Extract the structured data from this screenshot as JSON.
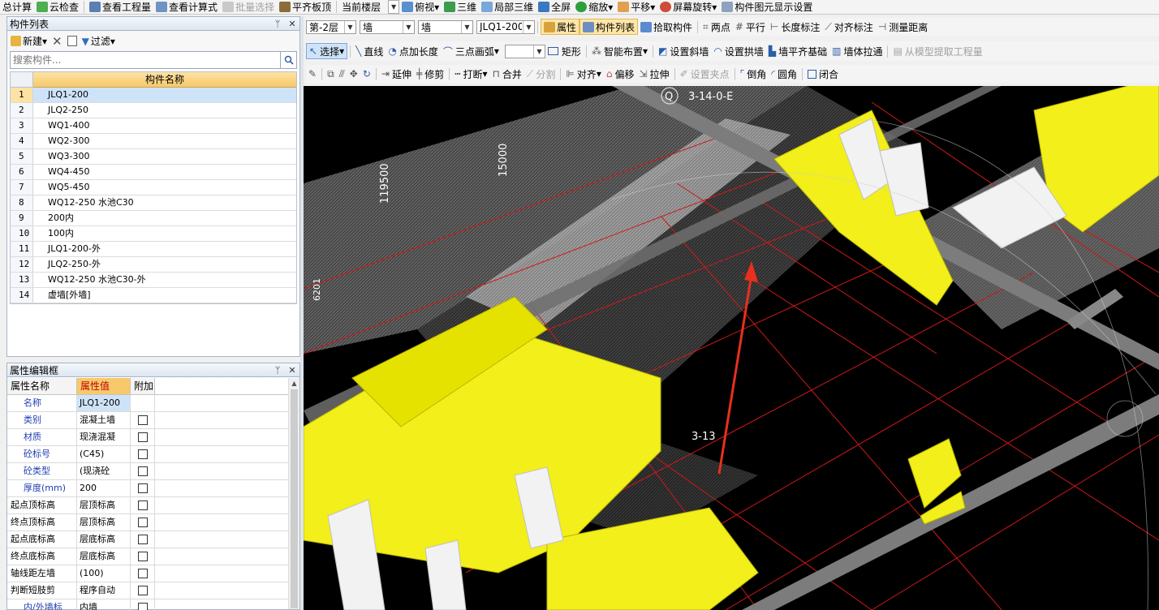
{
  "topbar": {
    "items": [
      "总计算",
      "云检查",
      "查看工程量",
      "查看计算式",
      "批量选择",
      "平齐板顶"
    ],
    "floor_label": "当前楼层",
    "view_buttons": [
      "俯视",
      "三维",
      "局部三维",
      "全屏",
      "缩放",
      "平移",
      "屏幕旋转",
      "构件图元显示设置"
    ]
  },
  "row1": {
    "floor": "第-2层",
    "type": "墙",
    "subtype": "墙",
    "component": "JLQ1-200",
    "buttons": [
      "属性",
      "构件列表",
      "拾取构件",
      "两点",
      "平行",
      "长度标注",
      "对齐标注",
      "测量距离"
    ]
  },
  "row2": {
    "select": "选择",
    "buttons": [
      "直线",
      "点加长度",
      "三点画弧",
      "矩形",
      "智能布置",
      "设置斜墙",
      "设置拱墙",
      "墙平齐基础",
      "墙体拉通",
      "从模型提取工程量"
    ]
  },
  "row3": {
    "buttons": [
      "延伸",
      "修剪",
      "打断",
      "合并",
      "分割",
      "对齐",
      "偏移",
      "拉伸",
      "设置夹点",
      "倒角",
      "圆角",
      "闭合"
    ]
  },
  "component_panel": {
    "title": "构件列表",
    "new_label": "新建",
    "filter_label": "过滤",
    "search_placeholder": "搜索构件...",
    "column_header": "构件名称",
    "rows": [
      {
        "no": "1",
        "name": "JLQ1-200"
      },
      {
        "no": "2",
        "name": "JLQ2-250"
      },
      {
        "no": "3",
        "name": "WQ1-400"
      },
      {
        "no": "4",
        "name": "WQ2-300"
      },
      {
        "no": "5",
        "name": "WQ3-300"
      },
      {
        "no": "6",
        "name": "WQ4-450"
      },
      {
        "no": "7",
        "name": "WQ5-450"
      },
      {
        "no": "8",
        "name": "WQ12-250 水池C30"
      },
      {
        "no": "9",
        "name": "200内"
      },
      {
        "no": "10",
        "name": "100内"
      },
      {
        "no": "11",
        "name": "JLQ1-200-外"
      },
      {
        "no": "12",
        "name": "JLQ2-250-外"
      },
      {
        "no": "13",
        "name": "WQ12-250 水池C30-外"
      },
      {
        "no": "14",
        "name": "虚墙[外墙]"
      }
    ]
  },
  "property_panel": {
    "title": "属性编辑框",
    "headers": [
      "属性名称",
      "属性值",
      "附加"
    ],
    "rows": [
      {
        "name": "名称",
        "value": "JLQ1-200",
        "blue": true,
        "check": false
      },
      {
        "name": "类别",
        "value": "混凝土墙",
        "blue": true,
        "check": true
      },
      {
        "name": "材质",
        "value": "现浇混凝",
        "blue": true,
        "check": true
      },
      {
        "name": "砼标号",
        "value": "(C45)",
        "blue": true,
        "check": true
      },
      {
        "name": "砼类型",
        "value": "(现浇砼",
        "blue": true,
        "check": true
      },
      {
        "name": "厚度(mm)",
        "value": "200",
        "blue": true,
        "check": true
      },
      {
        "name": "起点顶标高",
        "value": "层顶标高",
        "blue": false,
        "check": true
      },
      {
        "name": "终点顶标高",
        "value": "层顶标高",
        "blue": false,
        "check": true
      },
      {
        "name": "起点底标高",
        "value": "层底标高",
        "blue": false,
        "check": true
      },
      {
        "name": "终点底标高",
        "value": "层底标高",
        "blue": false,
        "check": true
      },
      {
        "name": "轴线距左墙",
        "value": "(100)",
        "blue": false,
        "check": true
      },
      {
        "name": "判断短肢剪",
        "value": "程序自动",
        "blue": false,
        "check": true
      },
      {
        "name": "内/外墙标",
        "value": "内墙",
        "blue": true,
        "check": true
      }
    ]
  },
  "viewport": {
    "labels": [
      "Q",
      "3-14-0-E",
      "15000",
      "119500",
      "3-13",
      "6201"
    ],
    "colors": {
      "background": "#000000",
      "wall": "#f2ef1a",
      "grid": "#d01818",
      "beam": "#7c7c7c",
      "arrow": "#e8301e"
    }
  }
}
